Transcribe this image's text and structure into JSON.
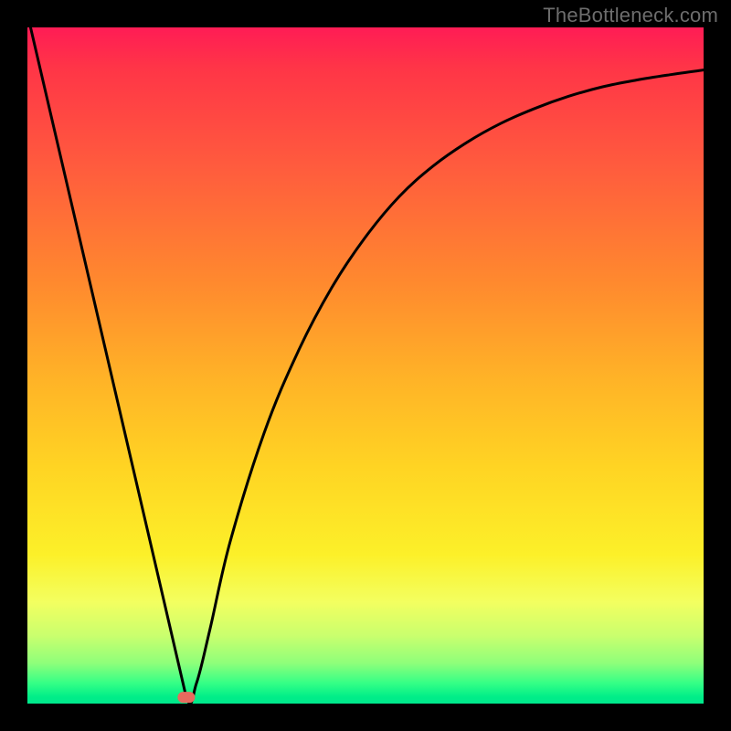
{
  "watermark": "TheBottleneck.com",
  "chart_data": {
    "type": "line",
    "title": "",
    "xlabel": "",
    "ylabel": "",
    "xlim": [
      0,
      100
    ],
    "ylim": [
      0,
      100
    ],
    "series": [
      {
        "name": "curve",
        "x": [
          0,
          5,
          10,
          15,
          20,
          23.5,
          25,
          27,
          30,
          35,
          40,
          45,
          50,
          55,
          60,
          65,
          70,
          75,
          80,
          85,
          90,
          95,
          100
        ],
        "values": [
          102,
          80.5,
          59.0,
          37.5,
          16.0,
          0.9,
          3.0,
          11.0,
          24.0,
          40.0,
          52.0,
          61.5,
          69.0,
          75.0,
          79.5,
          83.0,
          85.8,
          88.0,
          89.8,
          91.2,
          92.2,
          93.0,
          93.7
        ]
      }
    ],
    "marker": {
      "x": 23.5,
      "y": 0.9,
      "w": 2.6,
      "h": 1.6
    },
    "gradient_stops": [
      {
        "pct": 0,
        "color": "#ff1c55"
      },
      {
        "pct": 50,
        "color": "#ffb327"
      },
      {
        "pct": 85,
        "color": "#f3ff60"
      },
      {
        "pct": 100,
        "color": "#00e88c"
      }
    ]
  }
}
